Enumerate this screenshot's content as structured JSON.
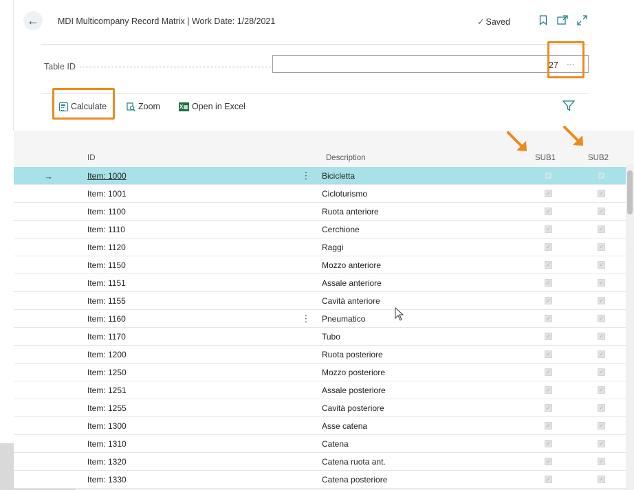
{
  "header": {
    "title": "MDI Multicompany Record Matrix | Work Date: 1/28/2021",
    "saved_label": "Saved",
    "icons": [
      "back-icon",
      "bookmark-icon",
      "open-new-window-icon",
      "expand-icon"
    ]
  },
  "field": {
    "label": "Table ID",
    "value": "27",
    "lookup": "···"
  },
  "toolbar": {
    "calculate_label": "Calculate",
    "zoom_label": "Zoom",
    "excel_label": "Open in Excel",
    "icons": [
      "calculator-icon",
      "zoom-icon",
      "excel-icon",
      "filter-icon"
    ]
  },
  "columns": {
    "id": "ID",
    "description": "Description",
    "sub1": "SUB1",
    "sub2": "SUB2"
  },
  "rows": [
    {
      "id": "Item: 1000",
      "description": "Bicicletta",
      "sub1": true,
      "sub2": true
    },
    {
      "id": "Item: 1001",
      "description": "Cicloturismo",
      "sub1": true,
      "sub2": true
    },
    {
      "id": "Item: 1100",
      "description": "Ruota anteriore",
      "sub1": true,
      "sub2": true
    },
    {
      "id": "Item: 1110",
      "description": "Cerchione",
      "sub1": true,
      "sub2": true
    },
    {
      "id": "Item: 1120",
      "description": "Raggi",
      "sub1": true,
      "sub2": true
    },
    {
      "id": "Item: 1150",
      "description": "Mozzo anteriore",
      "sub1": true,
      "sub2": true
    },
    {
      "id": "Item: 1151",
      "description": "Assale anteriore",
      "sub1": true,
      "sub2": true
    },
    {
      "id": "Item: 1155",
      "description": "Cavità anteriore",
      "sub1": true,
      "sub2": true
    },
    {
      "id": "Item: 1160",
      "description": "Pneumatico",
      "sub1": true,
      "sub2": true
    },
    {
      "id": "Item: 1170",
      "description": "Tubo",
      "sub1": true,
      "sub2": true
    },
    {
      "id": "Item: 1200",
      "description": "Ruota posteriore",
      "sub1": true,
      "sub2": true
    },
    {
      "id": "Item: 1250",
      "description": "Mozzo posteriore",
      "sub1": true,
      "sub2": true
    },
    {
      "id": "Item: 1251",
      "description": "Assale posteriore",
      "sub1": true,
      "sub2": true
    },
    {
      "id": "Item: 1255",
      "description": "Cavità posteriore",
      "sub1": true,
      "sub2": true
    },
    {
      "id": "Item: 1300",
      "description": "Asse catena",
      "sub1": true,
      "sub2": true
    },
    {
      "id": "Item: 1310",
      "description": "Catena",
      "sub1": true,
      "sub2": true
    },
    {
      "id": "Item: 1320",
      "description": "Catena ruota ant.",
      "sub1": true,
      "sub2": true
    },
    {
      "id": "Item: 1330",
      "description": "Catena posteriore",
      "sub1": true,
      "sub2": true
    }
  ],
  "colors": {
    "accent": "#1f7f86",
    "selected_row": "#a8e1e7",
    "highlight": "#ec8a1c"
  }
}
